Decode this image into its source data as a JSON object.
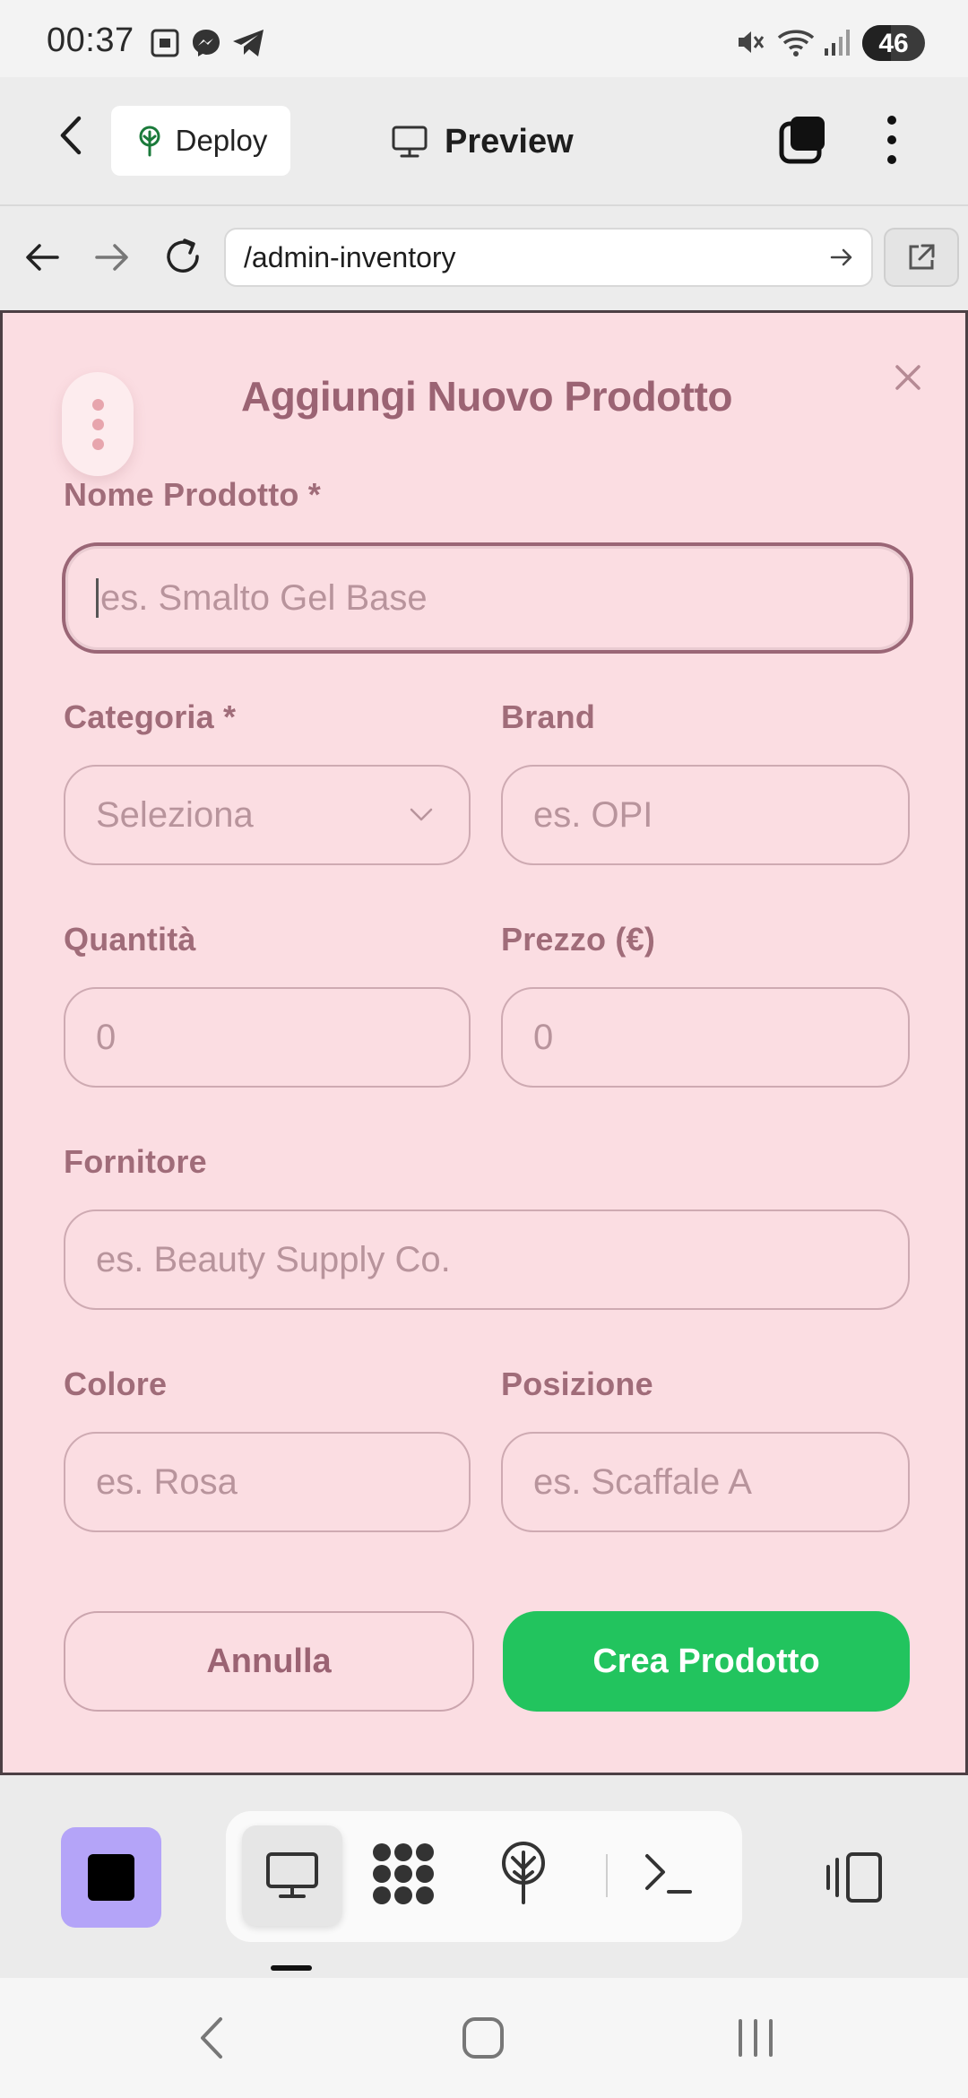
{
  "status_bar": {
    "time": "00:37",
    "battery": "46",
    "battery_fraction": 0.46
  },
  "header": {
    "deploy_label": "Deploy",
    "preview_label": "Preview"
  },
  "browser": {
    "url": "/admin-inventory"
  },
  "modal": {
    "title": "Aggiungi Nuovo Prodotto",
    "fields": {
      "product_name": {
        "label": "Nome Prodotto *",
        "placeholder": "es. Smalto Gel Base"
      },
      "category": {
        "label": "Categoria *",
        "value": "Seleziona"
      },
      "brand": {
        "label": "Brand",
        "placeholder": "es. OPI"
      },
      "quantity": {
        "label": "Quantità",
        "value": "0"
      },
      "price": {
        "label": "Prezzo (€)",
        "value": "0"
      },
      "supplier": {
        "label": "Fornitore",
        "placeholder": "es. Beauty Supply Co."
      },
      "color": {
        "label": "Colore",
        "placeholder": "es. Rosa"
      },
      "position": {
        "label": "Posizione",
        "placeholder": "es. Scaffale A"
      }
    },
    "buttons": {
      "cancel": "Annulla",
      "create": "Crea Prodotto"
    }
  },
  "colors": {
    "modal_background": "#fbdde2",
    "accent_text": "#9b6373",
    "primary_button": "#22c45e",
    "stop_button": "#b4a4f8"
  },
  "icons": {
    "status": [
      "screenshot-icon",
      "messenger-icon",
      "telegram-icon",
      "mute-icon",
      "wifi-icon",
      "signal-icon"
    ],
    "toolbar": [
      "stop-icon",
      "monitor-icon",
      "apps-grid-icon",
      "deploy-tree-icon",
      "terminal-icon",
      "split-view-icon"
    ]
  }
}
